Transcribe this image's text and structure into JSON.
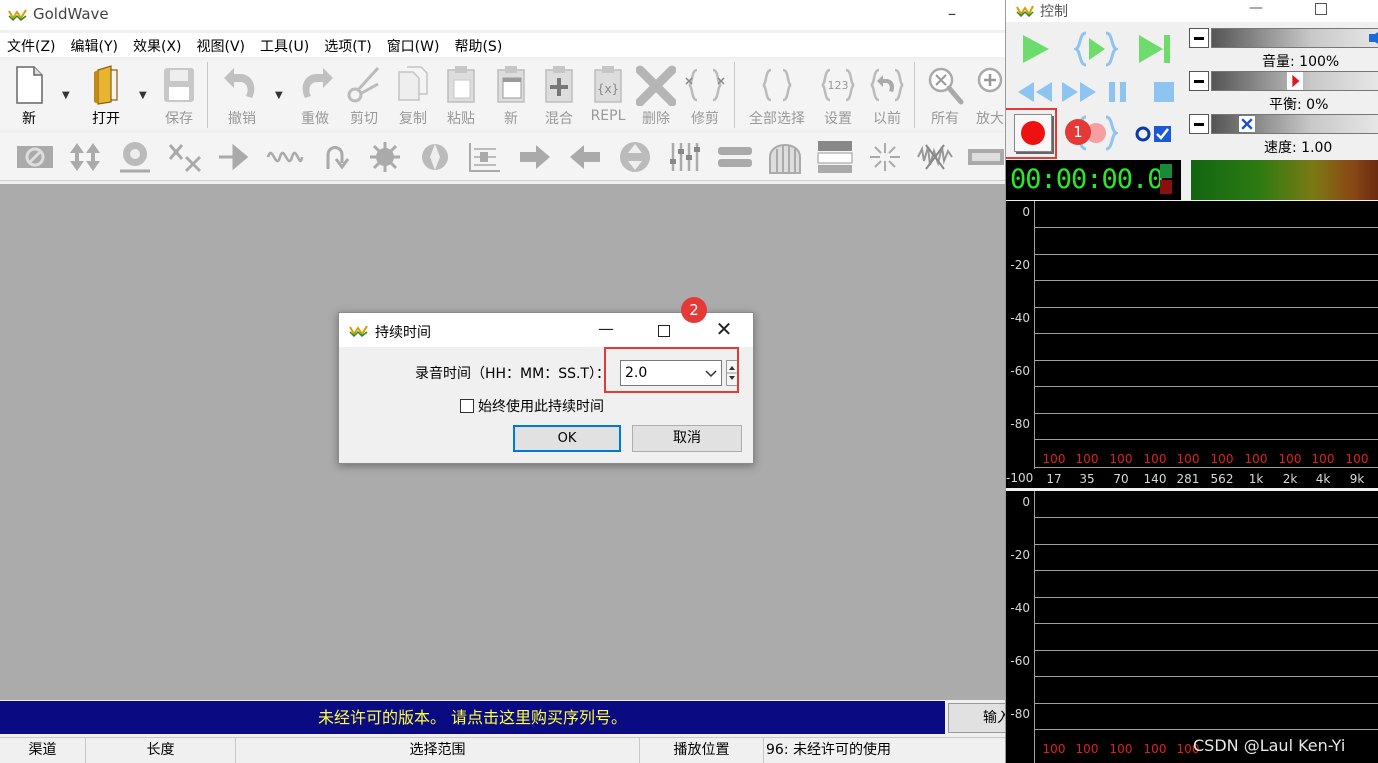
{
  "app": {
    "title": "GoldWave",
    "minimize_glyph": "–"
  },
  "menu": [
    "文件(Z)",
    "编辑(Y)",
    "效果(X)",
    "视图(V)",
    "工具(U)",
    "选项(T)",
    "窗口(W)",
    "帮助(S)"
  ],
  "toolbar": [
    {
      "id": "new",
      "label": "新",
      "icon": "new-file-icon",
      "active": true,
      "dropdown": true
    },
    {
      "id": "open",
      "label": "打开",
      "icon": "open-folder-icon",
      "active": true,
      "dropdown": true
    },
    {
      "id": "save",
      "label": "保存",
      "icon": "save-disk-icon",
      "active": false
    },
    {
      "id": "undo",
      "label": "撤销",
      "icon": "undo-icon",
      "active": false,
      "dropdown": true
    },
    {
      "id": "redo",
      "label": "重做",
      "icon": "redo-icon",
      "active": false
    },
    {
      "id": "cut",
      "label": "剪切",
      "icon": "scissors-icon",
      "active": false
    },
    {
      "id": "copy",
      "label": "复制",
      "icon": "copy-icon",
      "active": false
    },
    {
      "id": "paste",
      "label": "粘贴",
      "icon": "paste-icon",
      "active": false
    },
    {
      "id": "paste-new",
      "label": "新",
      "icon": "paste-new-icon",
      "active": false
    },
    {
      "id": "mix",
      "label": "混合",
      "icon": "mix-icon",
      "active": false
    },
    {
      "id": "replace",
      "label": "REPL",
      "icon": "replace-icon",
      "active": false
    },
    {
      "id": "delete",
      "label": "删除",
      "icon": "delete-x-icon",
      "active": false
    },
    {
      "id": "trim",
      "label": "修剪",
      "icon": "trim-icon",
      "active": false
    },
    {
      "id": "select-all",
      "label": "全部选择",
      "icon": "select-all-icon",
      "active": false
    },
    {
      "id": "set",
      "label": "设置",
      "icon": "set-123-icon",
      "active": false
    },
    {
      "id": "previous",
      "label": "以前",
      "icon": "previous-icon",
      "active": false
    },
    {
      "id": "zoom-all",
      "label": "所有",
      "icon": "zoom-all-icon",
      "active": false
    },
    {
      "id": "zoom-in",
      "label": "放大",
      "icon": "zoom-in-icon",
      "active": false
    }
  ],
  "effects_toolbar_icons": [
    "dc-offset-icon",
    "compress-icon",
    "echo-icon",
    "doppler-icon",
    "fade-icon",
    "flange-icon",
    "loop-icon",
    "filter-icon",
    "mechanize-icon",
    "offset-icon",
    "pitch-icon",
    "playback-rate-icon",
    "reverse-icon",
    "volume-icon",
    "equalizer-icon",
    "noise-gate-icon",
    "reverb-icon",
    "spectrum-icon",
    "time-warp-icon",
    "noise-reduction-icon",
    "more-effects-icon"
  ],
  "banner": {
    "text": "未经许可的版本。 请点击这里购买序列号。",
    "enter_label": "输入"
  },
  "statusbar": [
    "渠道",
    "长度",
    "选择范围",
    "播放位置",
    "96: 未经许可的使用"
  ],
  "dialog": {
    "title": "持续时间",
    "field_label": "录音时间（HH：MM：SS.T）：",
    "value": "2.0",
    "checkbox_label": "始终使用此持续时间",
    "checkbox_checked": false,
    "ok_label": "OK",
    "cancel_label": "取消"
  },
  "control": {
    "title": "控制",
    "volume_label": "音量: 100%",
    "volume_level": 1.0,
    "balance_label": "平衡: 0%",
    "balance_level": 0.0,
    "speed_label": "速度: 1.00",
    "speed_level": 1.0,
    "time": "00:00:00.0"
  },
  "meter": {
    "y_ticks": [
      "0",
      "-20",
      "-40",
      "-60",
      "-80",
      "-100"
    ],
    "bands": [
      "17",
      "35",
      "70",
      "140",
      "281",
      "562",
      "1k",
      "2k",
      "4k",
      "9k"
    ],
    "peak": "100"
  },
  "annotations": [
    "1",
    "2"
  ],
  "watermark": "CSDN @Laul Ken-Yi",
  "colors": {
    "banner_bg": "#0a0a82",
    "banner_text": "#ffff3c",
    "time_digits": "#29e829",
    "highlight": "#e53935",
    "peak_labels": "#e02020",
    "record_red": "#ee1111",
    "transport_green": "#6ddc6d",
    "transport_blue": "#8ec4f2"
  }
}
